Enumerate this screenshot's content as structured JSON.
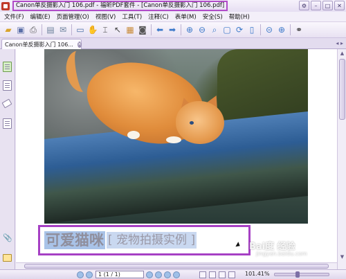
{
  "window": {
    "title": "Canon单反摄影入门 106.pdf - 福昕PDF套件 - [Canon单反摄影入门 106.pdf]"
  },
  "menu": {
    "items": [
      "文件(F)",
      "编辑(E)",
      "页面管理(O)",
      "视图(V)",
      "工具(T)",
      "注释(C)",
      "表单(M)",
      "安全(S)",
      "帮助(H)"
    ]
  },
  "tab": {
    "label": "Canon单反摄影入门 106..."
  },
  "caption": {
    "main": "可爱猫咪",
    "sub": "[ 宠物拍摄实例 ]"
  },
  "status": {
    "page": "1 (1 / 1)",
    "zoom": "101.41%"
  },
  "watermark": {
    "text": "Bai度 经验",
    "url": "jingyan.baidu.com"
  },
  "colors": {
    "highlight_frame": "#a640c4",
    "caption_highlight": "#a9c3e8"
  },
  "icons": [
    "open-icon",
    "save-icon",
    "print-icon",
    "hand-icon",
    "select-icon",
    "zoom-in-icon",
    "zoom-out-icon",
    "back-icon",
    "forward-icon",
    "binoculars-icon"
  ]
}
